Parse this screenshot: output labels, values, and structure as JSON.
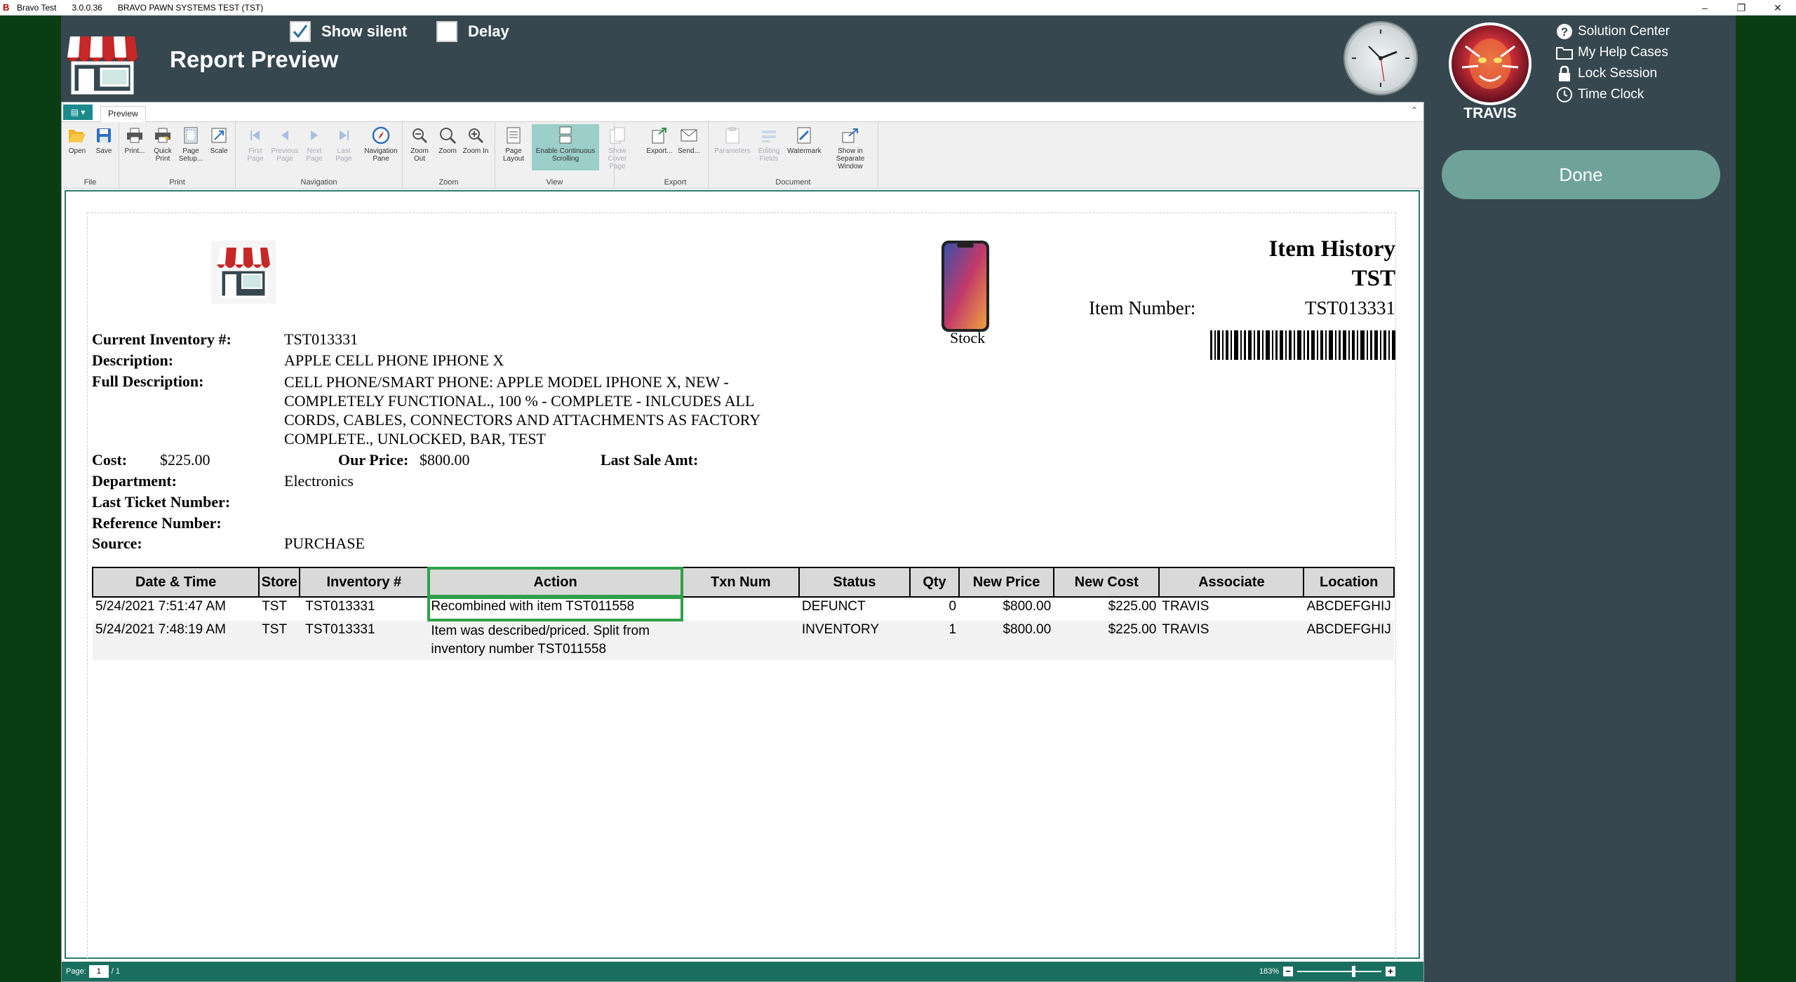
{
  "titlebar": {
    "app_name": "Bravo Test",
    "version": "3.0.0.36",
    "company": "BRAVO PAWN SYSTEMS TEST (TST)"
  },
  "header": {
    "title": "Report Preview",
    "show_silent_label": "Show silent",
    "show_silent_checked": true,
    "delay_label": "Delay",
    "delay_checked": false,
    "user_name": "TRAVIS",
    "help_links": [
      "Solution Center",
      "My Help Cases",
      "Lock Session",
      "Time Clock"
    ],
    "done_label": "Done"
  },
  "ribbon": {
    "tab_label": "Preview",
    "groups": {
      "file": "File",
      "print": "Print",
      "navigation": "Navigation",
      "zoom": "Zoom",
      "view": "View",
      "export": "Export",
      "document": "Document"
    },
    "buttons": {
      "open": "Open",
      "save": "Save",
      "print": "Print...",
      "quick_print": "Quick Print",
      "page_setup": "Page Setup...",
      "scale": "Scale",
      "first_page": "First Page",
      "previous_page": "Previous Page",
      "next_page": "Next Page",
      "last_page": "Last Page",
      "navigation_pane": "Navigation Pane",
      "zoom_out": "Zoom Out",
      "zoom": "Zoom",
      "zoom_in": "Zoom In",
      "page_layout": "Page Layout",
      "continuous_scrolling": "Enable Continuous Scrolling",
      "show_cover_page": "Show Cover Page",
      "export": "Export...",
      "send": "Send...",
      "parameters": "Parameters",
      "editing_fields": "Editing Fields",
      "watermark": "Watermark",
      "separate_window": "Show in Separate Window"
    }
  },
  "report": {
    "title": "Item History",
    "store_code": "TST",
    "item_number_label": "Item Number:",
    "item_number": "TST013331",
    "stock_label": "Stock",
    "fields": {
      "current_inventory_label": "Current Inventory #:",
      "current_inventory": "TST013331",
      "description_label": "Description:",
      "description": "APPLE CELL PHONE IPHONE X",
      "full_description_label": "Full Description:",
      "full_description_lines": [
        "CELL PHONE/SMART PHONE: APPLE MODEL IPHONE X, NEW -",
        "COMPLETELY FUNCTIONAL., 100 % - COMPLETE - INLCUDES ALL",
        "CORDS, CABLES, CONNECTORS AND ATTACHMENTS AS FACTORY",
        "COMPLETE., UNLOCKED, BAR, TEST"
      ],
      "cost_label": "Cost:",
      "cost": "$225.00",
      "our_price_label": "Our Price:",
      "our_price": "$800.00",
      "last_sale_label": "Last Sale Amt:",
      "department_label": "Department:",
      "department": "Electronics",
      "last_ticket_label": "Last Ticket Number:",
      "reference_label": "Reference Number:",
      "source_label": "Source:",
      "source": "PURCHASE"
    },
    "table": {
      "columns": [
        "Date & Time",
        "Store",
        "Inventory #",
        "Action",
        "Txn Num",
        "Status",
        "Qty",
        "New Price",
        "New Cost",
        "Associate",
        "Location"
      ],
      "rows": [
        [
          "5/24/2021 7:51:47 AM",
          "TST",
          "TST013331",
          "Recombined with item TST011558",
          "",
          "DEFUNCT",
          "0",
          "$800.00",
          "$225.00",
          "TRAVIS",
          "ABCDEFGHIJ"
        ],
        [
          "5/24/2021 7:48:19 AM",
          "TST",
          "TST013331",
          "Item was described/priced. Split from inventory number TST011558",
          "",
          "INVENTORY",
          "1",
          "$800.00",
          "$225.00",
          "TRAVIS",
          "ABCDEFGHIJ"
        ]
      ]
    }
  },
  "statusbar": {
    "page_label": "Page:",
    "page_current": "1",
    "page_total": "/ 1",
    "zoom": "183%"
  }
}
